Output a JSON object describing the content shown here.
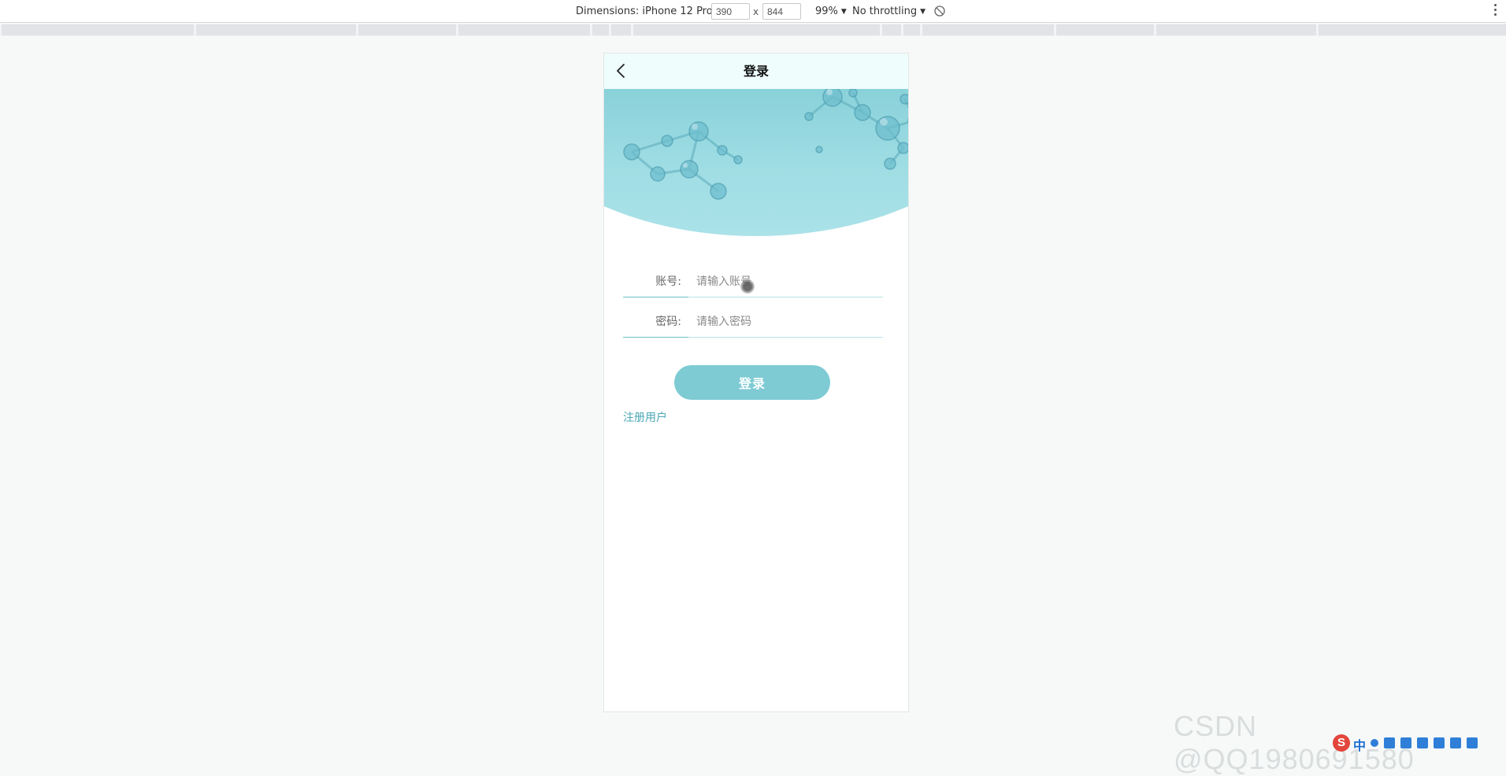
{
  "devtools": {
    "dimensions_label": "Dimensions: iPhone 12 Pro",
    "width_value": "390",
    "height_value": "844",
    "times_sign": "x",
    "zoom_label": "99%",
    "throttling_label": "No throttling"
  },
  "app": {
    "title": "登录",
    "account_label": "账号:",
    "account_placeholder": "请输入账号",
    "password_label": "密码:",
    "password_placeholder": "请输入密码",
    "login_button": "登录",
    "register_link": "注册用户"
  },
  "colors": {
    "accent": "#7ecbd4",
    "nav_bg": "#effdfd",
    "link": "#4aa7b5"
  },
  "watermark": "CSDN @QQ1980691580",
  "ime": {
    "logo": "S",
    "mode": "中"
  }
}
